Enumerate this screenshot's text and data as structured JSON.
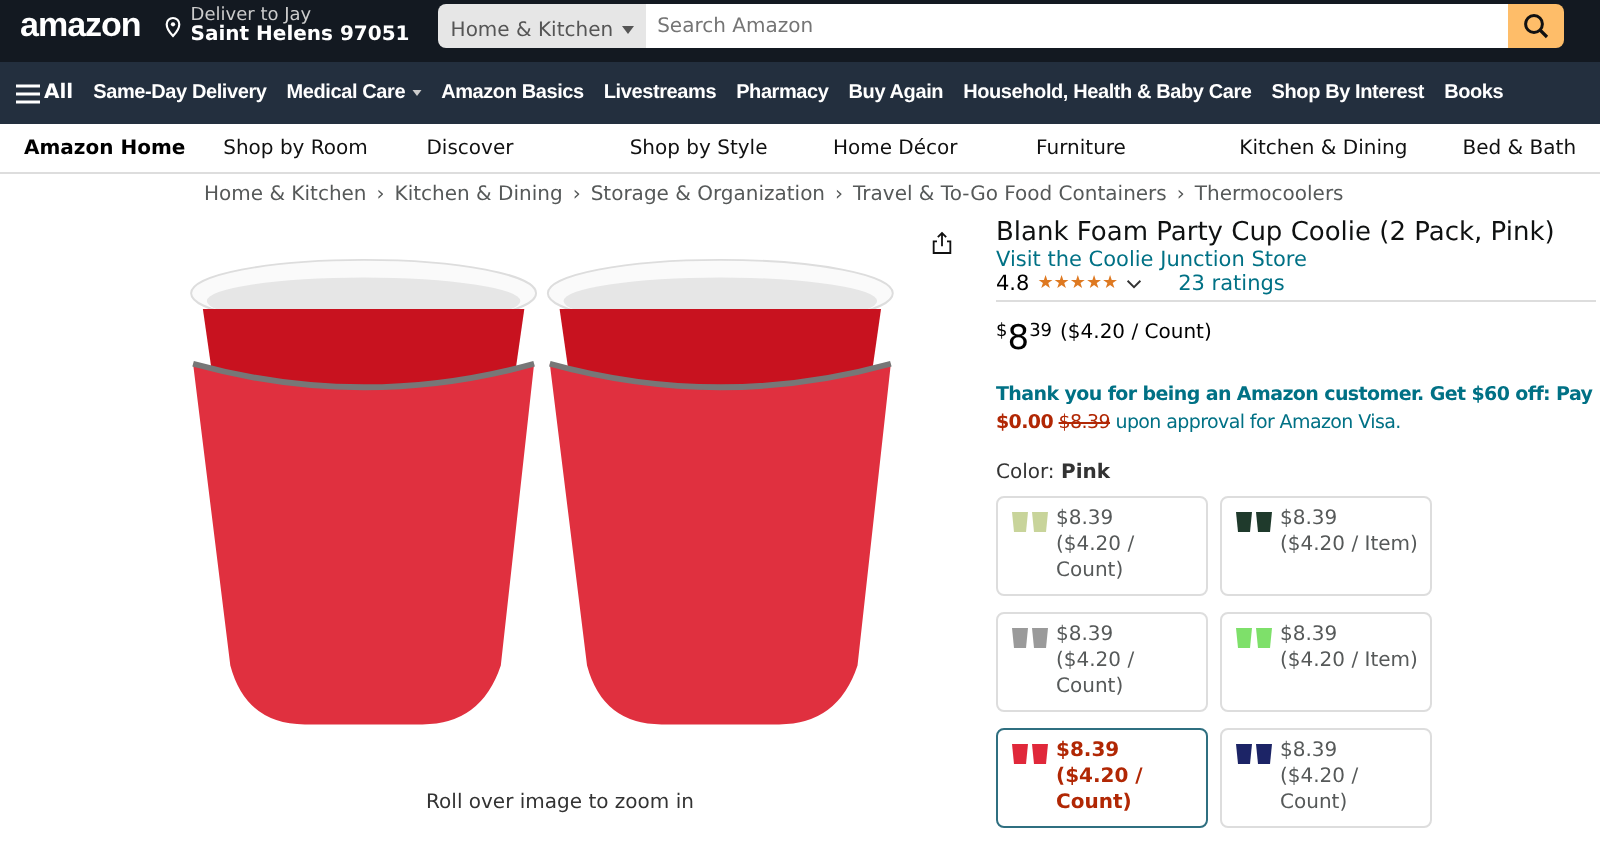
{
  "header": {
    "logo": "amazon",
    "deliver_to": "Deliver to Jay",
    "location": "Saint Helens 97051",
    "search_category": "Home & Kitchen",
    "search_placeholder": "Search Amazon"
  },
  "nav": {
    "menu_label": "All",
    "items": [
      {
        "label": "Same-Day Delivery",
        "dropdown": false
      },
      {
        "label": "Medical Care",
        "dropdown": true
      },
      {
        "label": "Amazon Basics",
        "dropdown": false
      },
      {
        "label": "Livestreams",
        "dropdown": false
      },
      {
        "label": "Pharmacy",
        "dropdown": false
      },
      {
        "label": "Buy Again",
        "dropdown": false
      },
      {
        "label": "Household, Health & Baby Care",
        "dropdown": false
      },
      {
        "label": "Shop By Interest",
        "dropdown": false
      },
      {
        "label": "Books",
        "dropdown": false
      }
    ]
  },
  "store_nav": {
    "home": "Amazon Home",
    "items": [
      "Shop by Room",
      "Discover",
      "Shop by Style",
      "Home Décor",
      "Furniture",
      "Kitchen & Dining",
      "Bed & Bath"
    ]
  },
  "breadcrumbs": [
    "Home & Kitchen",
    "Kitchen & Dining",
    "Storage & Organization",
    "Travel & To-Go Food Containers",
    "Thermocoolers"
  ],
  "breadcrumb_separator": "›",
  "image_caption": "Roll over image to zoom in",
  "product": {
    "title": "Blank Foam Party Cup Coolie (2 Pack, Pink)",
    "store_link": "Visit the Coolie Junction Store",
    "rating": "4.8",
    "stars": 5,
    "ratings_count": "23 ratings",
    "price_symbol": "$",
    "price_whole": "8",
    "price_fraction": "39",
    "unit_price": "($4.20 / Count)",
    "offer_line": "Thank you for being an Amazon customer. Get $60 off: Pay",
    "offer_price": "$0.00",
    "offer_old_price": "$8.39",
    "offer_rest": "upon approval for Amazon Visa.",
    "color_label": "Color:",
    "color_value": "Pink"
  },
  "swatches": [
    {
      "price": "$8.39",
      "unit": "($4.20 / Count)",
      "color": "#c8d49a",
      "selected": false
    },
    {
      "price": "$8.39",
      "unit": "($4.20 / Item)",
      "color": "#1f3a2c",
      "selected": false
    },
    {
      "price": "$8.39",
      "unit": "($4.20 / Count)",
      "color": "#9a9a9a",
      "selected": false
    },
    {
      "price": "$8.39",
      "unit": "($4.20 / Item)",
      "color": "#7ee06a",
      "selected": false
    },
    {
      "price": "$8.39",
      "unit": "($4.20 / Count)",
      "color": "#e0283a",
      "selected": true
    },
    {
      "price": "$8.39",
      "unit": "($4.20 / Count)",
      "color": "#1c2466",
      "selected": false
    }
  ]
}
